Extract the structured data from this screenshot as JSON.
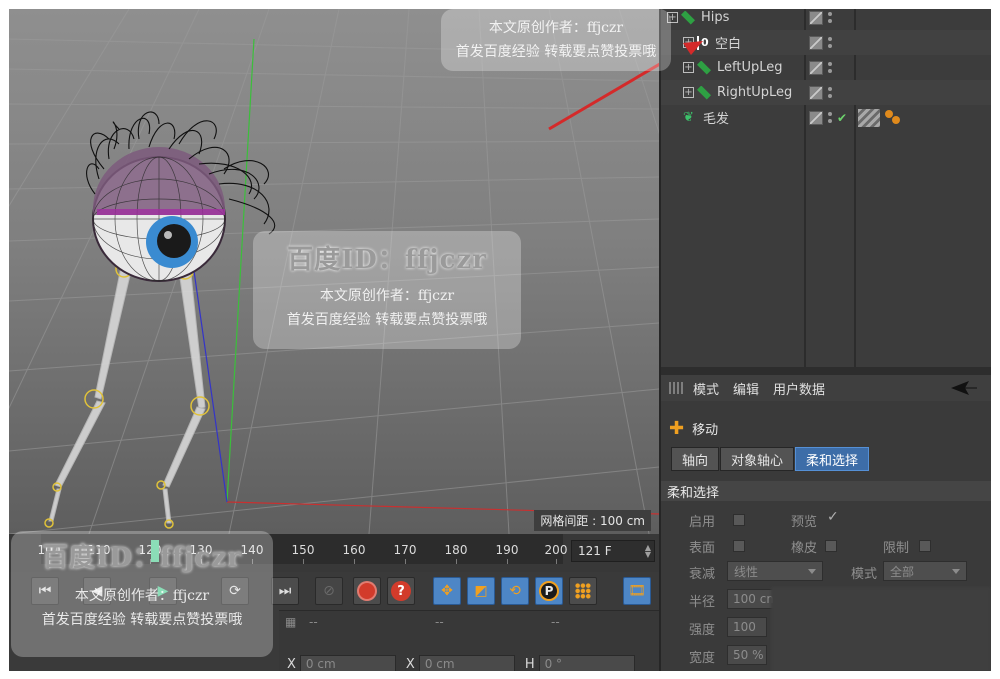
{
  "viewport": {
    "grid_spacing": "网格间距 : 100 cm"
  },
  "object_manager": {
    "objects": [
      {
        "name": "Hips",
        "icon": "bone-icon"
      },
      {
        "name": "空白",
        "icon": "null-icon"
      },
      {
        "name": "LeftUpLeg",
        "icon": "bone-icon"
      },
      {
        "name": "RightUpLeg",
        "icon": "bone-icon"
      },
      {
        "name": "毛发",
        "icon": "hair-icon"
      }
    ]
  },
  "attribute_manager": {
    "menu": [
      "模式",
      "编辑",
      "用户数据"
    ],
    "tool_name": "移动",
    "tabs": [
      "轴向",
      "对象轴心",
      "柔和选择"
    ],
    "active_tab": "柔和选择",
    "section_title": "柔和选择",
    "fields": {
      "enable": "启用",
      "preview": "预览",
      "surface": "表面",
      "rubber": "橡皮",
      "restrict": "限制",
      "falloff": "衰减",
      "falloff_value": "线性",
      "mode": "模式",
      "mode_value": "全部",
      "radius": "半径",
      "radius_value": "100 cm",
      "strength": "强度",
      "strength_value": "100",
      "width": "宽度",
      "width_value": "50 %"
    }
  },
  "timeline": {
    "ticks": [
      "100",
      "110",
      "120",
      "130",
      "140",
      "150",
      "160",
      "170",
      "180",
      "190",
      "200"
    ],
    "current_frame_field": "121 F"
  },
  "coordinates": {
    "headers": [
      "--",
      "--",
      "--"
    ],
    "x_label": "X",
    "x_value": "0 cm",
    "x2_label": "X",
    "x2_value": "0 cm",
    "h_label": "H",
    "h_value": "0 °"
  },
  "watermarks": {
    "id": "百度ID：ffjczr",
    "author": "本文原创作者：ffjczr",
    "notice": "首发百度经验 转载要点赞投票哦"
  },
  "colors": {
    "accent_blue": "#3d6da8",
    "accent_orange": "#f0a020",
    "record_red": "#d23b2b",
    "annotation_arrow": "#d42a2a"
  }
}
